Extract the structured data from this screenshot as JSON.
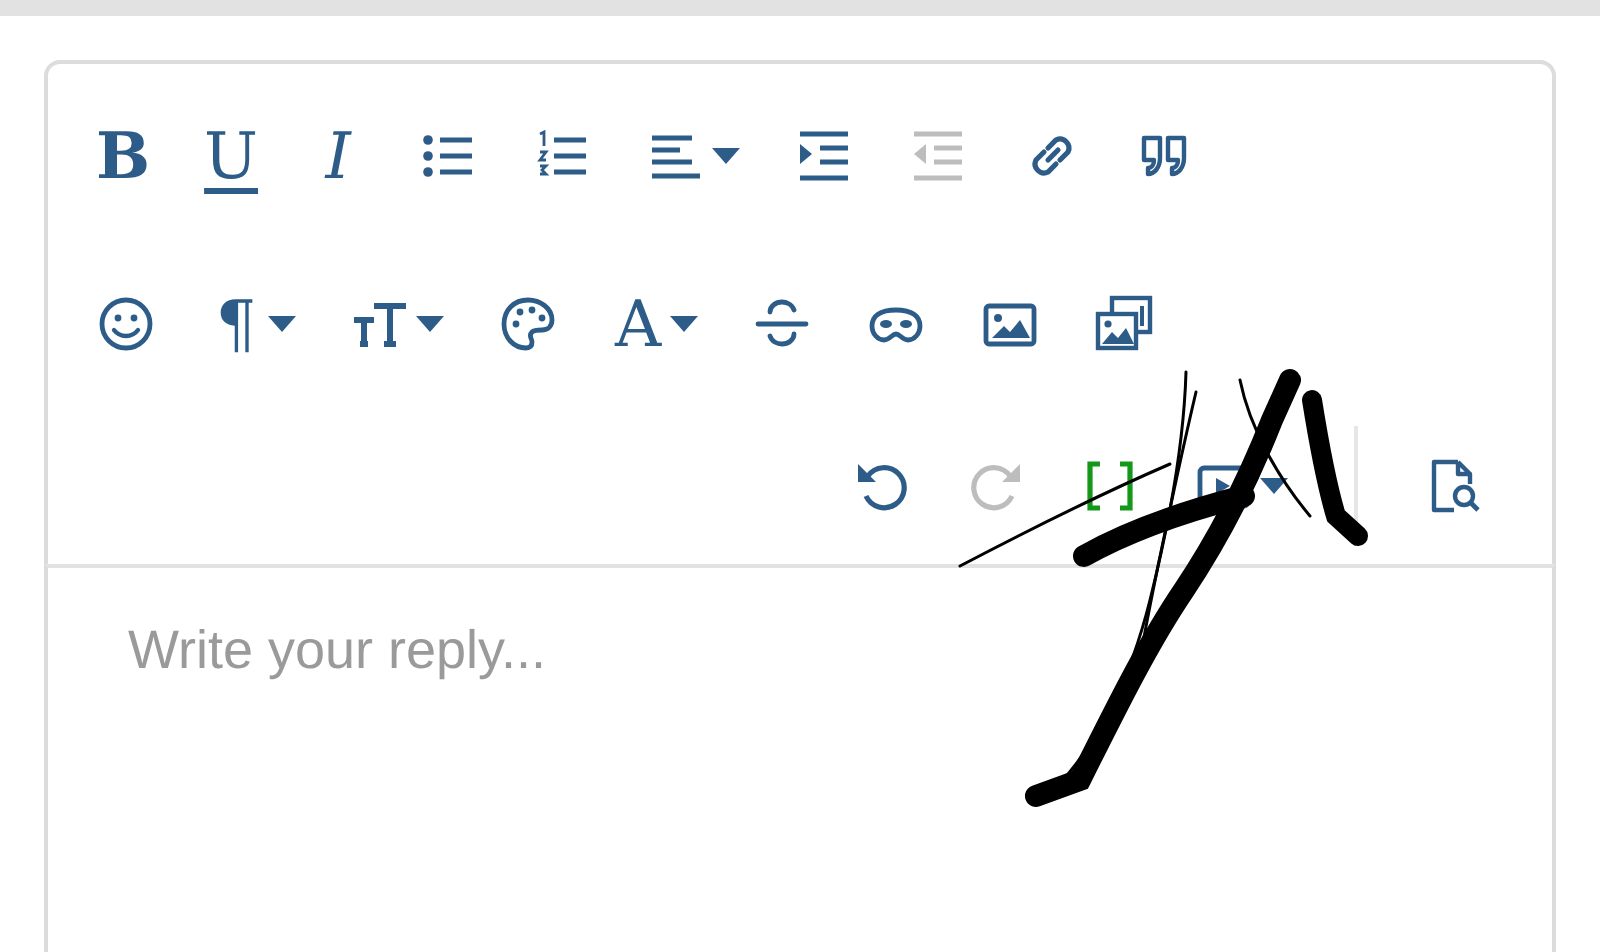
{
  "editor": {
    "toolbar": {
      "rows": [
        {
          "buttons": [
            {
              "kind": "bold",
              "text": "B",
              "dropdown": false,
              "disabled": false,
              "on": false
            },
            {
              "kind": "underline",
              "text": "U",
              "dropdown": false,
              "disabled": false,
              "on": false
            },
            {
              "kind": "italic",
              "text": "I",
              "dropdown": false,
              "disabled": false,
              "on": false
            },
            {
              "kind": "bullet-list",
              "dropdown": false,
              "disabled": false,
              "on": false
            },
            {
              "kind": "numbered-list",
              "dropdown": false,
              "disabled": false,
              "on": false
            },
            {
              "kind": "align",
              "dropdown": true,
              "disabled": false,
              "on": false
            },
            {
              "kind": "indent",
              "dropdown": false,
              "disabled": false,
              "on": false
            },
            {
              "kind": "outdent",
              "dropdown": false,
              "disabled": true,
              "on": false
            },
            {
              "kind": "link",
              "dropdown": false,
              "disabled": false,
              "on": false
            },
            {
              "kind": "quote",
              "dropdown": false,
              "disabled": false,
              "on": false
            }
          ]
        },
        {
          "buttons": [
            {
              "kind": "smiley",
              "dropdown": false,
              "disabled": false,
              "on": false
            },
            {
              "kind": "paragraph",
              "text": "¶",
              "dropdown": true,
              "disabled": false,
              "on": false
            },
            {
              "kind": "font-size",
              "dropdown": true,
              "disabled": false,
              "on": false
            },
            {
              "kind": "palette",
              "dropdown": false,
              "disabled": false,
              "on": false
            },
            {
              "kind": "font",
              "text": "A",
              "dropdown": true,
              "disabled": false,
              "on": false
            },
            {
              "kind": "strike",
              "dropdown": false,
              "disabled": false,
              "on": false
            },
            {
              "kind": "mask",
              "dropdown": false,
              "disabled": false,
              "on": false
            },
            {
              "kind": "image",
              "dropdown": false,
              "disabled": false,
              "on": false
            },
            {
              "kind": "gallery",
              "dropdown": false,
              "disabled": false,
              "on": false
            }
          ]
        },
        {
          "buttons": [
            {
              "kind": "undo",
              "dropdown": false,
              "disabled": false,
              "on": false
            },
            {
              "kind": "redo",
              "dropdown": false,
              "disabled": true,
              "on": false
            },
            {
              "kind": "brackets",
              "dropdown": false,
              "disabled": false,
              "on": true
            },
            {
              "kind": "media",
              "dropdown": true,
              "disabled": false,
              "on": false
            },
            {
              "kind": "separator"
            },
            {
              "kind": "preview",
              "dropdown": false,
              "disabled": false,
              "on": false
            }
          ]
        }
      ]
    },
    "body": {
      "placeholder": "Write your reply..."
    }
  }
}
